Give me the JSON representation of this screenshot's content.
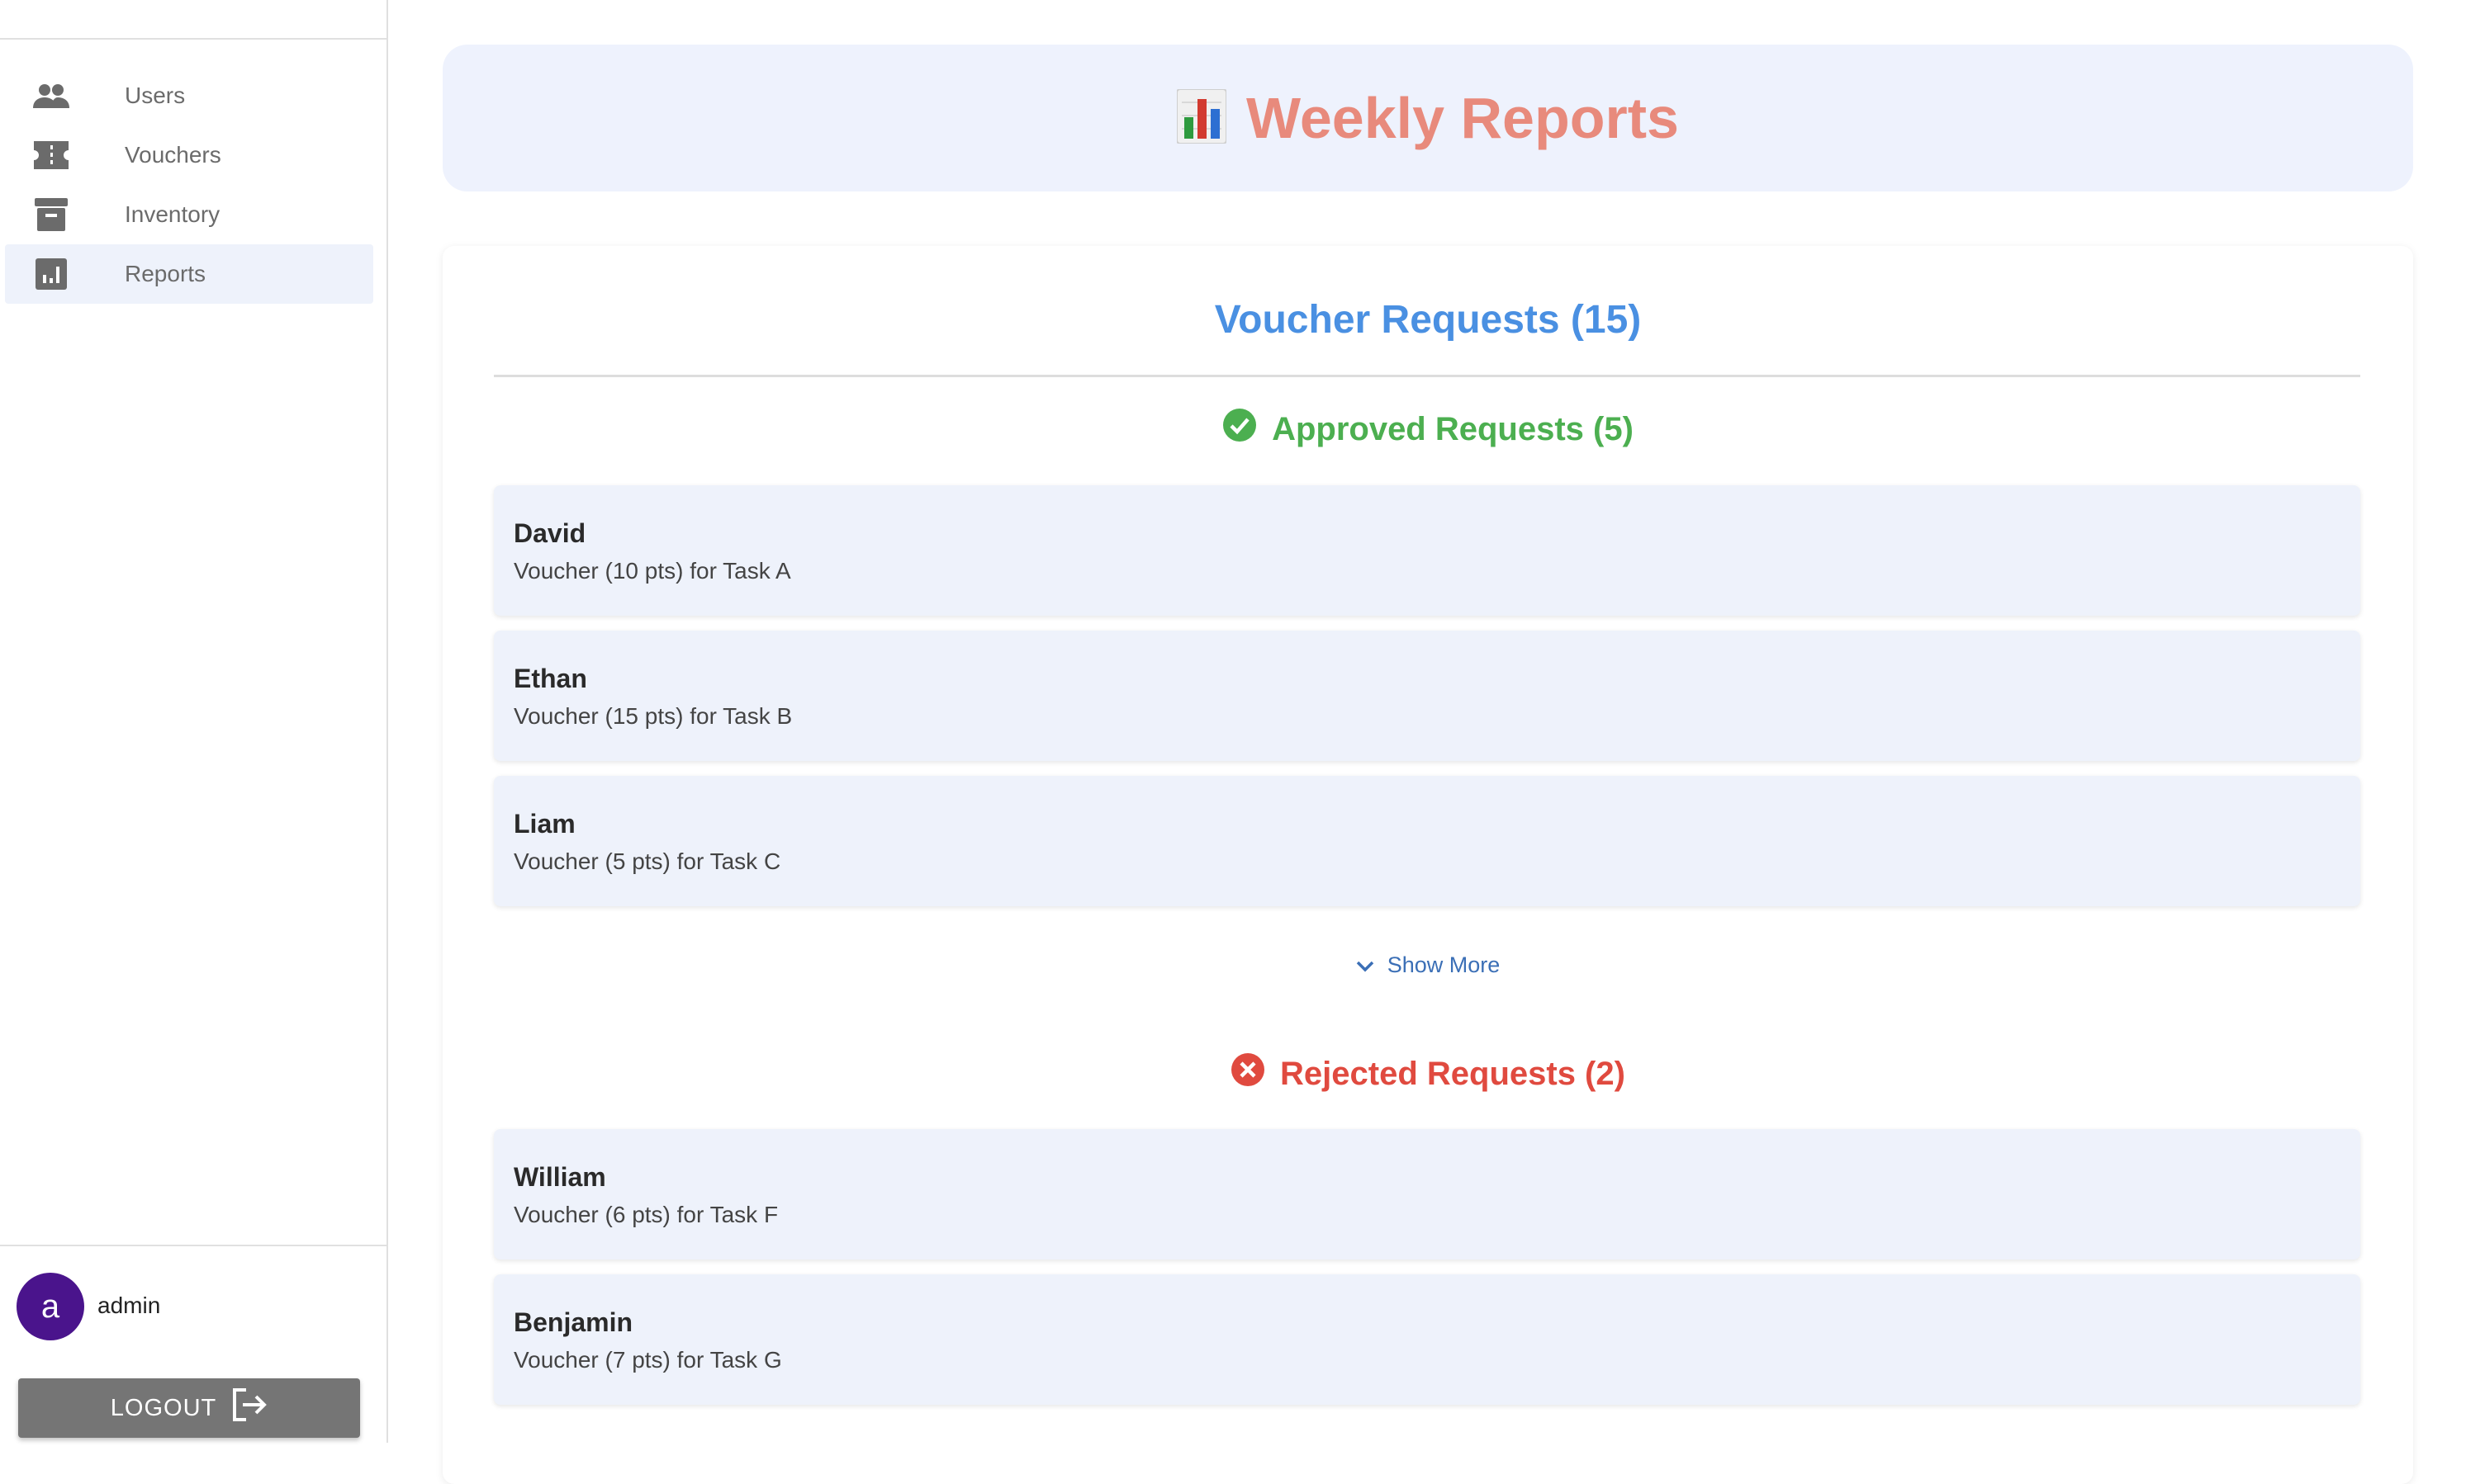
{
  "sidebar": {
    "items": [
      {
        "label": "Users",
        "icon": "users-icon"
      },
      {
        "label": "Vouchers",
        "icon": "ticket-icon"
      },
      {
        "label": "Inventory",
        "icon": "archive-icon"
      },
      {
        "label": "Reports",
        "icon": "bar-chart-icon",
        "active": true
      }
    ],
    "user": {
      "avatar_letter": "a",
      "name": "admin"
    },
    "logout_label": "LOGOUT"
  },
  "header": {
    "emoji": "📊",
    "title": "Weekly Reports"
  },
  "report": {
    "title": "Voucher Requests (15)",
    "approved": {
      "title": "Approved Requests (5)",
      "items": [
        {
          "name": "David",
          "desc": "Voucher (10 pts) for Task A"
        },
        {
          "name": "Ethan",
          "desc": "Voucher (15 pts) for Task B"
        },
        {
          "name": "Liam",
          "desc": "Voucher (5 pts) for Task C"
        }
      ],
      "show_more_label": "Show More"
    },
    "rejected": {
      "title": "Rejected Requests (2)",
      "items": [
        {
          "name": "William",
          "desc": "Voucher (6 pts) for Task F"
        },
        {
          "name": "Benjamin",
          "desc": "Voucher (7 pts) for Task G"
        }
      ]
    }
  },
  "colors": {
    "accent_blue": "#4a90e2",
    "approved_green": "#4caf50",
    "rejected_red": "#e04a3f",
    "header_title": "#e88a7c",
    "avatar_purple": "#4a148c"
  }
}
